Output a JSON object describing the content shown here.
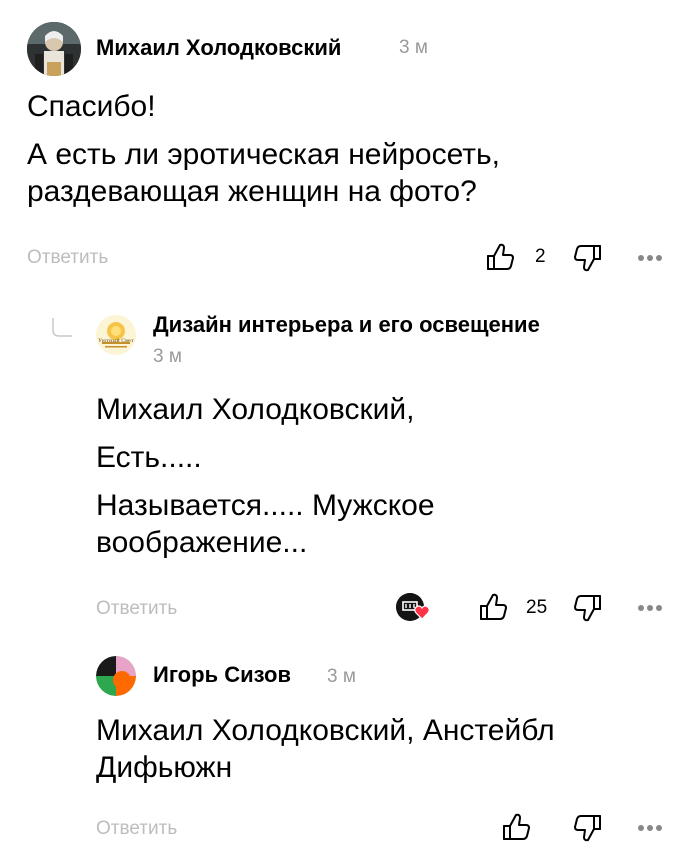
{
  "comments": [
    {
      "author": "Михаил Холодковский",
      "time": "3 м",
      "paragraphs": [
        "Спасибо!",
        "А есть ли эротическая нейросеть, раздевающая женщин на фото?"
      ],
      "reply_label": "Ответить",
      "likes": "2"
    },
    {
      "author": "Дизайн интерьера и его освещение",
      "time": "3 м",
      "avatar_caption": "Уютный Свет",
      "paragraphs": [
        "Михаил Холодковский,",
        "Есть.....",
        "Называется..... Мужское воображение..."
      ],
      "reply_label": "Ответить",
      "likes": "25"
    },
    {
      "author": "Игорь Сизов",
      "time": "3 м",
      "paragraphs": [
        "Михаил Холодковский, Анстейбл Дифьюжн"
      ],
      "reply_label": "Ответить",
      "likes": ""
    }
  ],
  "colors": {
    "muted": "#9a9a9a",
    "reply": "#bdbdbd",
    "heart": "#ff3347",
    "avatar_orange": "#ff6a00",
    "avatar_green": "#2ea84f",
    "avatar_pink": "#e8a3c8"
  },
  "icons": [
    "thumb-up-icon",
    "thumb-down-icon",
    "more-dots-icon",
    "reply-thread-icon",
    "author-liked-heart-icon"
  ]
}
